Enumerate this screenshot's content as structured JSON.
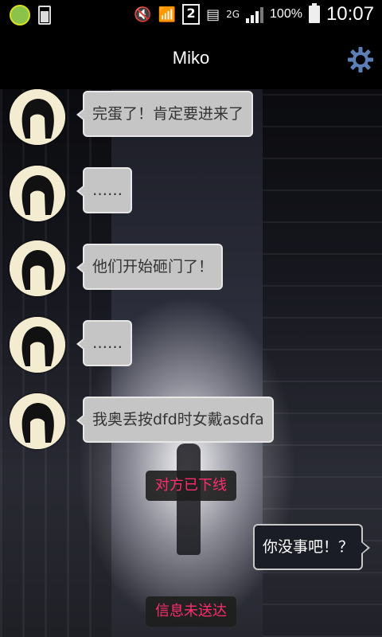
{
  "status_bar": {
    "sim_number": "2",
    "network": "2G",
    "battery_percent": "100%",
    "time": "10:07"
  },
  "header": {
    "title": "Miko",
    "settings_icon": "gear-icon"
  },
  "messages": [
    {
      "side": "in",
      "text": "完蛋了！肯定要进来了"
    },
    {
      "side": "in",
      "text": "……"
    },
    {
      "side": "in",
      "text": "他们开始砸门了！"
    },
    {
      "side": "in",
      "text": "……"
    },
    {
      "side": "in",
      "text": "我奥丢按dfd时女戴asdfa"
    }
  ],
  "notice_offline": "对方已下线",
  "outgoing": {
    "side": "out",
    "text": "你没事吧！？"
  },
  "notice_failed": "信息未送达",
  "colors": {
    "notice_text": "#ff2d6e",
    "incoming_bubble": "#c5c5c5",
    "outgoing_bubble": "#1a1d26",
    "gear": "#5b7fb6"
  }
}
